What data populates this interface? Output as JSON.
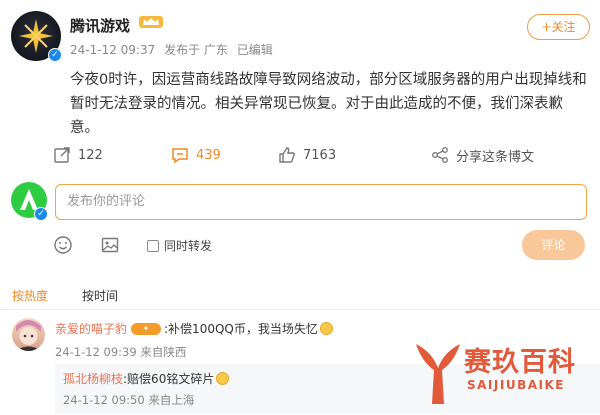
{
  "post": {
    "author": "腾讯游戏",
    "date": "24-1-12 09:37",
    "location": "发布于 广东",
    "edited": "已编辑",
    "follow_label": "+关注",
    "text": "今夜0时许，因运营商线路故障导致网络波动，部分区域服务器的用户出现掉线和暂时无法登录的情况。相关异常现已恢复。对于由此造成的不便，我们深表歉意。"
  },
  "actions": {
    "repost_count": "122",
    "comment_count": "439",
    "like_count": "7163",
    "share_label": "分享这条博文"
  },
  "composer": {
    "placeholder": "发布你的评论",
    "repost_option": "同时转发",
    "submit_label": "评论"
  },
  "sort_tabs": {
    "hot": "按热度",
    "time": "按时间"
  },
  "comment": {
    "user": "亲爱的喵子豹",
    "text": ":补偿100QQ币，我当场失忆",
    "date": "24-1-12 09:39",
    "location": "来自陕西"
  },
  "reply": {
    "user": "孤北杨柳枝",
    "text": ":赔偿60铭文碎片",
    "date": "24-1-12 09:50",
    "location": "来自上海"
  },
  "watermark": {
    "title": "赛玖百科",
    "subtitle": "SAIJIUBAIKE"
  },
  "colors": {
    "accent": "#f08a24",
    "username": "#eb7350",
    "verified": "#1a8ae8",
    "submit_disabled": "#f8c89b"
  }
}
